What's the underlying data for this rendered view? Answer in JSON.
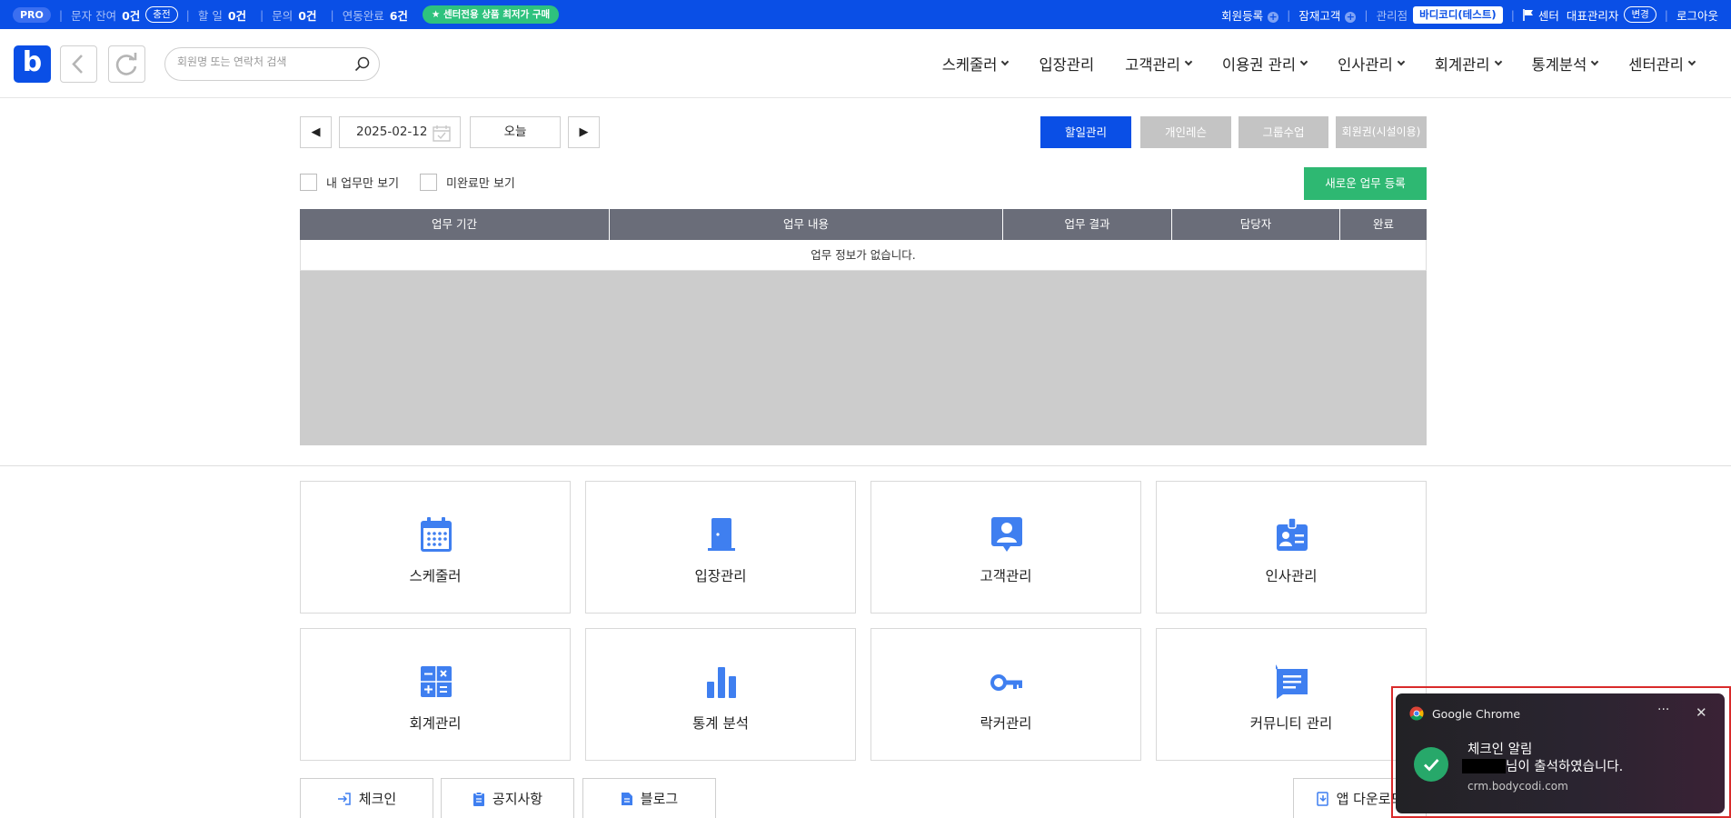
{
  "topbar": {
    "plan_badge": "PRO",
    "sms_label": "문자 잔여",
    "sms_value": "0건",
    "sms_charge": "충전",
    "todo_label": "할 일",
    "todo_value": "0건",
    "inquiry_label": "문의",
    "inquiry_value": "0건",
    "linked_label": "연동완료",
    "linked_value": "6건",
    "promo": "★ 센터전용 상품 최저가 구매",
    "member_register": "회원등록",
    "prospect": "잠재고객",
    "branch_label": "관리점",
    "branch_name": "바디코디(테스트)",
    "center_label": "센터",
    "admin_name": "대표관리자",
    "change": "변경",
    "logout": "로그아웃"
  },
  "header": {
    "logo": "b",
    "search_placeholder": "회원명 또는 연락처 검색",
    "menu": [
      "스케줄러",
      "입장관리",
      "고객관리",
      "이용권 관리",
      "인사관리",
      "회계관리",
      "통계분석",
      "센터관리"
    ]
  },
  "datebar": {
    "prev": "◀",
    "date": "2025-02-12",
    "today": "오늘",
    "next": "▶"
  },
  "tabs": [
    "할일관리",
    "개인레슨",
    "그룹수업",
    "회원권(시설이용)"
  ],
  "filters": {
    "my_tasks": "내 업무만 보기",
    "incomplete": "미완료만 보기",
    "new_task": "새로운 업무 등록"
  },
  "table": {
    "headers": [
      "업무 기간",
      "업무 내용",
      "업무 결과",
      "담당자",
      "완료"
    ],
    "empty_message": "업무 정보가 없습니다."
  },
  "shortcuts": [
    {
      "label": "스케줄러",
      "icon": "calendar-icon"
    },
    {
      "label": "입장관리",
      "icon": "door-icon"
    },
    {
      "label": "고객관리",
      "icon": "customer-icon"
    },
    {
      "label": "인사관리",
      "icon": "id-badge-icon"
    },
    {
      "label": "회계관리",
      "icon": "calculator-icon"
    },
    {
      "label": "통계 분석",
      "icon": "bar-chart-icon"
    },
    {
      "label": "락커관리",
      "icon": "key-icon"
    },
    {
      "label": "커뮤니티 관리",
      "icon": "message-icon"
    }
  ],
  "bottom": {
    "checkin": "체크인",
    "notice": "공지사항",
    "blog": "블로그",
    "app_download": "앱 다운로드"
  },
  "toast": {
    "app": "Google Chrome",
    "more": "···",
    "close": "✕",
    "title": "체크인 알림",
    "message": "님이 출석하였습니다.",
    "source": "crm.bodycodi.com"
  },
  "colors": {
    "brand_blue": "#0a4fe6",
    "green": "#2eb872",
    "icon_blue": "#3f7ff0",
    "table_header": "#6a6d79"
  }
}
